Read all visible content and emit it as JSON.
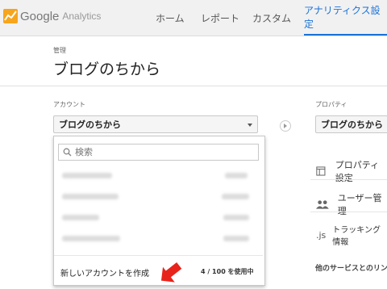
{
  "header": {
    "logo_google": "Google",
    "logo_analytics": "Analytics",
    "nav": {
      "home": "ホーム",
      "report": "レポート",
      "custom": "カスタム",
      "admin": "アナリティクス設定"
    }
  },
  "page": {
    "breadcrumb": "管理",
    "title": "ブログのちから"
  },
  "account": {
    "label": "アカウント",
    "selected": "ブログのちから",
    "search_placeholder": "検索",
    "create_label": "新しいアカウントを作成",
    "usage": "4 / 100 を使用中"
  },
  "property": {
    "label": "プロパティ",
    "selected": "ブログのちから",
    "items": {
      "settings": "プロパティ設定",
      "users": "ユーザー管理",
      "tracking": "トラッキング情報"
    },
    "js_label": ".js",
    "more": "他のサービスとのリンク"
  },
  "colors": {
    "accent": "#1a73d8",
    "arrow": "#e8231b"
  }
}
